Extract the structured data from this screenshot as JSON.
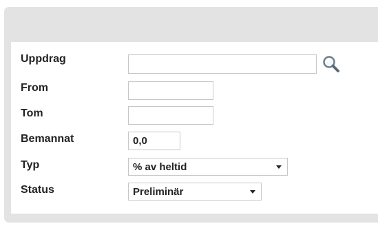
{
  "form": {
    "uppdrag": {
      "label": "Uppdrag",
      "value": ""
    },
    "from": {
      "label": "From",
      "value": ""
    },
    "tom": {
      "label": "Tom",
      "value": ""
    },
    "bemannat": {
      "label": "Bemannat",
      "value": "0,0"
    },
    "typ": {
      "label": "Typ",
      "selected": "% av heltid"
    },
    "status": {
      "label": "Status",
      "selected": "Preliminär"
    }
  },
  "icons": {
    "search": "search-icon",
    "dropdown": "chevron-down-icon"
  },
  "colors": {
    "panel_bg": "#e3e3e3",
    "field_border": "#c6c6c6",
    "text": "#222222"
  }
}
